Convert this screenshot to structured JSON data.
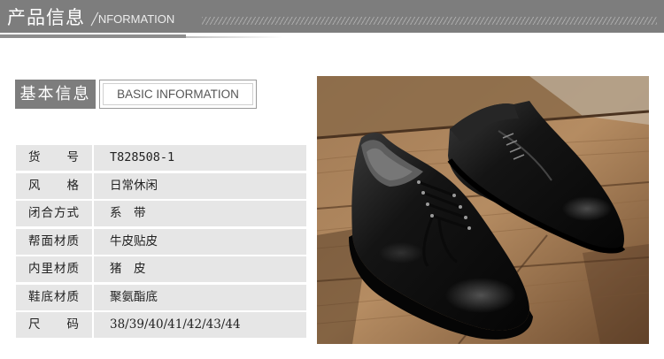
{
  "banner": {
    "title": "产品信息",
    "subtitle": "╱NFORMATION"
  },
  "section": {
    "title": "基本信息",
    "subtitle": "BASIC INFORMATION"
  },
  "specs": [
    {
      "label": "货号",
      "value": "T828508-1"
    },
    {
      "label": "风格",
      "value": "日常休闲"
    },
    {
      "label": "闭合方式",
      "value": "系　带"
    },
    {
      "label": "帮面材质",
      "value": "牛皮贴皮"
    },
    {
      "label": "内里材质",
      "value": "猪　皮"
    },
    {
      "label": "鞋底材质",
      "value": "聚氨酯底"
    },
    {
      "label": "尺码",
      "value": "38/39/40/41/42/43/44"
    }
  ],
  "photo": {
    "subject": "black-leather-lace-up-derby-shoes-on-wood",
    "colors": {
      "wood_light": "#b58c62",
      "wood_dark": "#5e4129",
      "leather": "#141414"
    }
  }
}
